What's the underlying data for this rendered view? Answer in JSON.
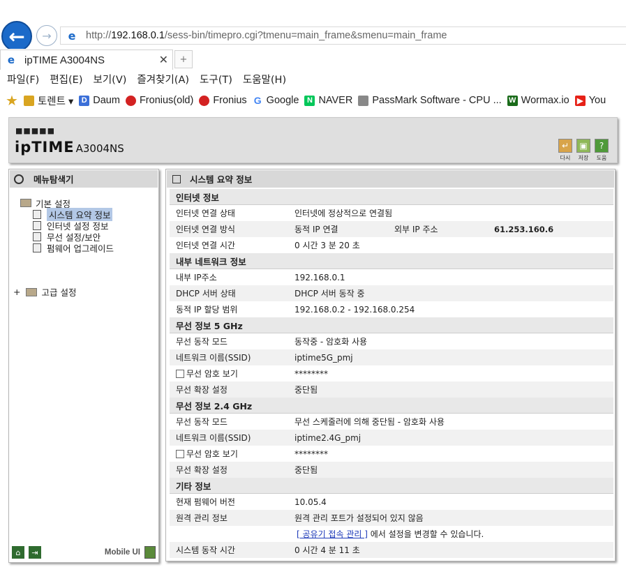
{
  "browser": {
    "url_prefix": "http://",
    "url_host": "192.168.0.1",
    "url_path": "/sess-bin/timepro.cgi?tmenu=main_frame&smenu=main_frame",
    "tab_title": "ipTIME A3004NS",
    "menu": [
      "파일(F)",
      "편집(E)",
      "보기(V)",
      "즐겨찾기(A)",
      "도구(T)",
      "도움말(H)"
    ],
    "favorites": [
      {
        "label": "토렌트 ▾",
        "color": "#d9a521"
      },
      {
        "label": "Daum",
        "color": "#3b6fd8"
      },
      {
        "label": "Fronius(old)",
        "color": "#d32222"
      },
      {
        "label": "Fronius",
        "color": "#d32222"
      },
      {
        "label": "Google",
        "color": "#4285f4"
      },
      {
        "label": "NAVER",
        "color": "#03c75a"
      },
      {
        "label": "PassMark Software - CPU ...",
        "color": "#888888"
      },
      {
        "label": "Wormax.io",
        "color": "#1a6b1a"
      },
      {
        "label": "You",
        "color": "#e62117"
      }
    ]
  },
  "header": {
    "logo_dots": "■■■■■",
    "logo_brand": "ipTIME",
    "model": "A3004NS",
    "buttons": [
      {
        "label": "다시",
        "icon": "back-arrow-icon",
        "color": "#d8a44a"
      },
      {
        "label": "저장",
        "icon": "save-icon",
        "color": "#8fb858"
      },
      {
        "label": "도움",
        "icon": "help-icon",
        "color": "#4f9a3a"
      }
    ]
  },
  "sidebar": {
    "title": "메뉴탐색기",
    "basic": "기본 설정",
    "items": [
      "시스템 요약 정보",
      "인터넷 설정 정보",
      "무선 설정/보안",
      "펌웨어 업그레이드"
    ],
    "advanced": "고급 설정",
    "mobile": "Mobile UI"
  },
  "content": {
    "title": "시스템 요약 정보",
    "internet": {
      "title": "인터넷 정보",
      "status_k": "인터넷 연결 상태",
      "status_v": "인터넷에 정상적으로 연결됨",
      "method_k": "인터넷 연결 방식",
      "method_v": "동적 IP 연결",
      "extip_k": "외부 IP 주소",
      "extip_v": "61.253.160.6",
      "time_k": "인터넷 연결 시간",
      "time_v": "0 시간 3 분 20 초"
    },
    "lan": {
      "title": "내부 네트워크 정보",
      "ip_k": "내부 IP주소",
      "ip_v": "192.168.0.1",
      "dhcp_k": "DHCP 서버 상태",
      "dhcp_v": "DHCP 서버 동작 중",
      "range_k": "동적 IP 할당 범위",
      "range_v": "192.168.0.2 -  192.168.0.254"
    },
    "w5": {
      "title": "무선 정보 5 GHz",
      "mode_k": "무선 동작 모드",
      "mode_v": "동작중 - 암호화 사용",
      "ssid_k": "네트워크 이름(SSID)",
      "ssid_v": "iptime5G_pmj",
      "pw_k": "무선 암호 보기",
      "pw_v": "********",
      "ext_k": "무선 확장 설정",
      "ext_v": "중단됨"
    },
    "w24": {
      "title": "무선 정보 2.4 GHz",
      "mode_k": "무선 동작 모드",
      "mode_v": "무선 스케줄러에 의해 중단됨 - 암호화 사용",
      "ssid_k": "네트워크 이름(SSID)",
      "ssid_v": "iptime2.4G_pmj",
      "pw_k": "무선 암호 보기",
      "pw_v": "********",
      "ext_k": "무선 확장 설정",
      "ext_v": "중단됨"
    },
    "etc": {
      "title": "기타 정보",
      "fw_k": "현재 펌웨어 버전",
      "fw_v": "10.05.4",
      "remote_k": "원격 관리 정보",
      "remote_v": "원격 관리 포트가 설정되어 있지 않음",
      "remote_link": "[ 공유기 접속 관리 ]",
      "remote_suffix": " 에서 설정을 변경할 수 있습니다.",
      "uptime_k": "시스템 동작 시간",
      "uptime_v": "0 시간 4 분 11 초"
    }
  }
}
